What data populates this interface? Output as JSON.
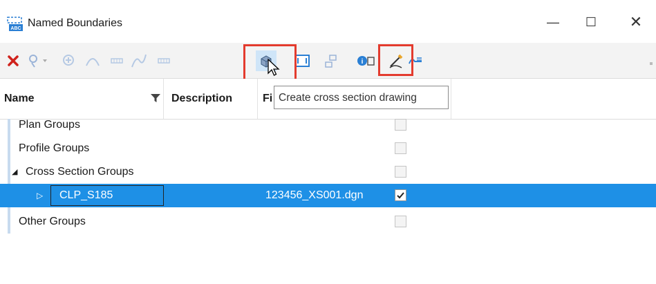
{
  "window": {
    "title": "Named Boundaries",
    "minimize": "—",
    "maximize": "☐",
    "close": "✕"
  },
  "toolbar": {
    "icons": [
      "delete-icon",
      "place-named-boundary-icon",
      "add-civil-icon",
      "arc-icon",
      "grid-icon",
      "curve-icon",
      "grid2-icon",
      "create-cross-section-icon",
      "fit-view-icon",
      "hierarchy-icon",
      "properties-icon",
      "draw-pen-icon",
      "profile-icon"
    ],
    "highlight_color": "#e33b2e"
  },
  "columns": {
    "name": "Name",
    "description": "Description",
    "file": "Fi"
  },
  "tooltip": {
    "text": "Create cross section drawing"
  },
  "rows": [
    {
      "label": "Plan Groups",
      "file": "",
      "checked": false
    },
    {
      "label": "Profile Groups",
      "file": "",
      "checked": false
    },
    {
      "label": "Cross Section Groups",
      "file": "",
      "checked": false,
      "expander": "◢"
    },
    {
      "label": "CLP_S185",
      "file": "123456_XS001.dgn",
      "checked": true,
      "expander": "▷"
    },
    {
      "label": "Other Groups",
      "file": "",
      "checked": false
    }
  ],
  "colors": {
    "selection": "#1e90e6",
    "delete": "#d0221c"
  }
}
